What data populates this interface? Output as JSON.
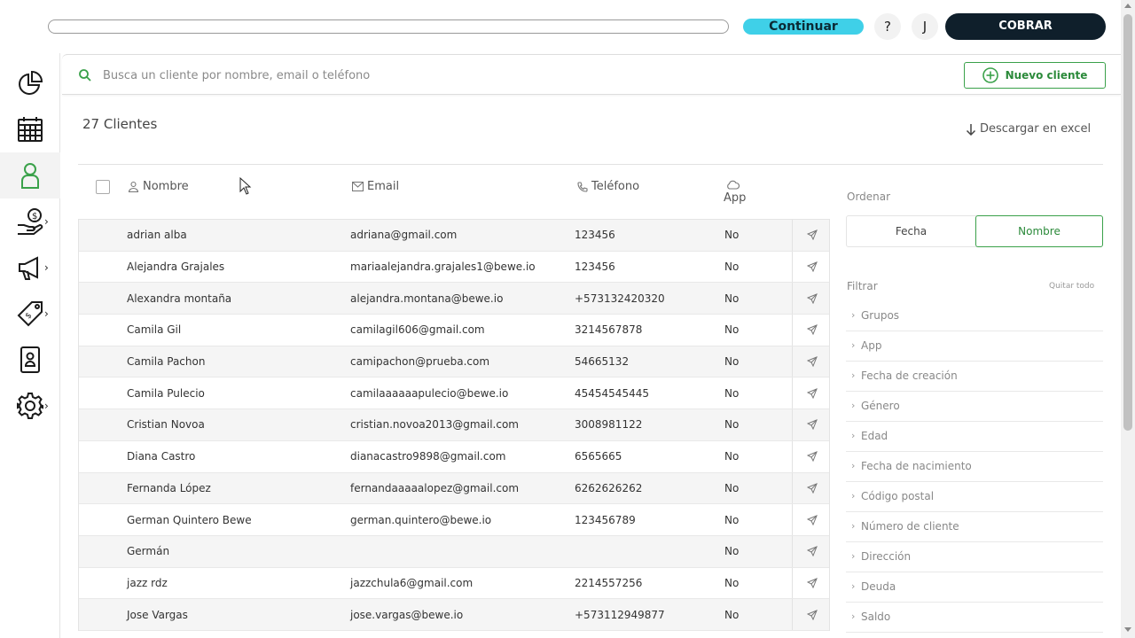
{
  "topbar": {
    "continuar_label": "Continuar",
    "help_label": "?",
    "user_initial": "J",
    "cobrar_label": "COBRAR"
  },
  "sidebar": {
    "items": [
      {
        "icon": "pie-chart-icon"
      },
      {
        "icon": "calendar-icon"
      },
      {
        "icon": "user-icon",
        "active": true
      },
      {
        "icon": "money-hand-icon",
        "has_submenu": true
      },
      {
        "icon": "megaphone-icon",
        "has_submenu": true
      },
      {
        "icon": "price-tag-icon",
        "has_submenu": true
      },
      {
        "icon": "id-badge-icon"
      },
      {
        "icon": "gear-icon",
        "has_submenu": true
      }
    ]
  },
  "search": {
    "placeholder": "Busca un cliente por nombre, email o teléfono",
    "new_client_label": "Nuevo cliente"
  },
  "main": {
    "count_title": "27 Clientes",
    "download_label": "Descargar en excel"
  },
  "table": {
    "headers": {
      "name": "Nombre",
      "email": "Email",
      "phone": "Teléfono",
      "app": "App"
    },
    "rows": [
      {
        "name": "adrian alba",
        "email": "adriana@gmail.com",
        "phone": "123456",
        "app": "No"
      },
      {
        "name": "Alejandra Grajales",
        "email": "mariaalejandra.grajales1@bewe.io",
        "phone": "123456",
        "app": "No"
      },
      {
        "name": "Alexandra montaña",
        "email": "alejandra.montana@bewe.io",
        "phone": "+573132420320",
        "app": "No"
      },
      {
        "name": "Camila Gil",
        "email": "camilagil606@gmail.com",
        "phone": "3214567878",
        "app": "No"
      },
      {
        "name": "Camila Pachon",
        "email": "camipachon@prueba.com",
        "phone": "54665132",
        "app": "No"
      },
      {
        "name": "Camila Pulecio",
        "email": "camilaaaaaapulecio@bewe.io",
        "phone": "45454545445",
        "app": "No"
      },
      {
        "name": "Cristian Novoa",
        "email": "cristian.novoa2013@gmail.com",
        "phone": "3008981122",
        "app": "No"
      },
      {
        "name": "Diana Castro",
        "email": "dianacastro9898@gmail.com",
        "phone": "6565665",
        "app": "No"
      },
      {
        "name": "Fernanda López",
        "email": "fernandaaaaalopez@gmail.com",
        "phone": "6262626262",
        "app": "No"
      },
      {
        "name": "German Quintero Bewe",
        "email": "german.quintero@bewe.io",
        "phone": "123456789",
        "app": "No"
      },
      {
        "name": "Germán",
        "email": "",
        "phone": "",
        "app": "No"
      },
      {
        "name": "jazz rdz",
        "email": "jazzchula6@gmail.com",
        "phone": "2214557256",
        "app": "No"
      },
      {
        "name": "Jose Vargas",
        "email": "jose.vargas@bewe.io",
        "phone": "+573112949877",
        "app": "No"
      }
    ]
  },
  "panel": {
    "order_label": "Ordenar",
    "sort_date": "Fecha",
    "sort_name": "Nombre",
    "filter_label": "Filtrar",
    "clear_all": "Quitar todo",
    "filters": [
      "Grupos",
      "App",
      "Fecha de creación",
      "Género",
      "Edad",
      "Fecha de nacimiento",
      "Código postal",
      "Número de cliente",
      "Dirección",
      "Deuda",
      "Saldo"
    ]
  },
  "colors": {
    "accent_green": "#3aa14a",
    "cyan": "#3fd0e8",
    "dark": "#0f1f2b"
  }
}
